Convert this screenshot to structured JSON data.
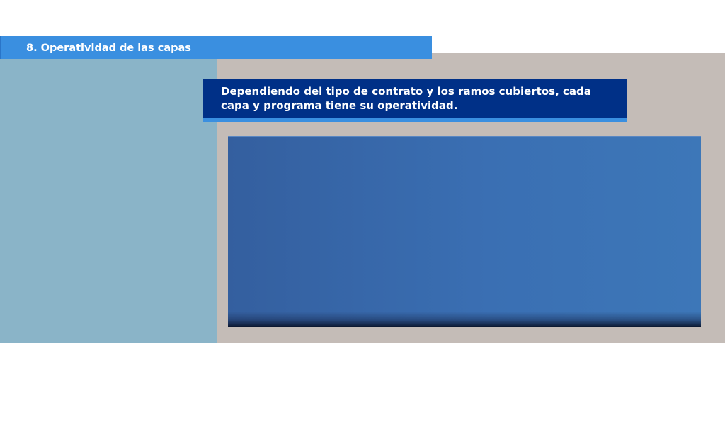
{
  "section": {
    "title": "8.  Operatividad de las capas"
  },
  "intro": {
    "text": "Dependiendo del tipo de contrato y los ramos cubiertos, cada capa y programa tiene su operatividad."
  },
  "colors": {
    "title_bar": "#3a8fe0",
    "subtitle_box": "#003087",
    "left_panel": "#8ab4c8",
    "right_panel": "#c4bcb7",
    "content_panel": "#3a6fb3"
  }
}
